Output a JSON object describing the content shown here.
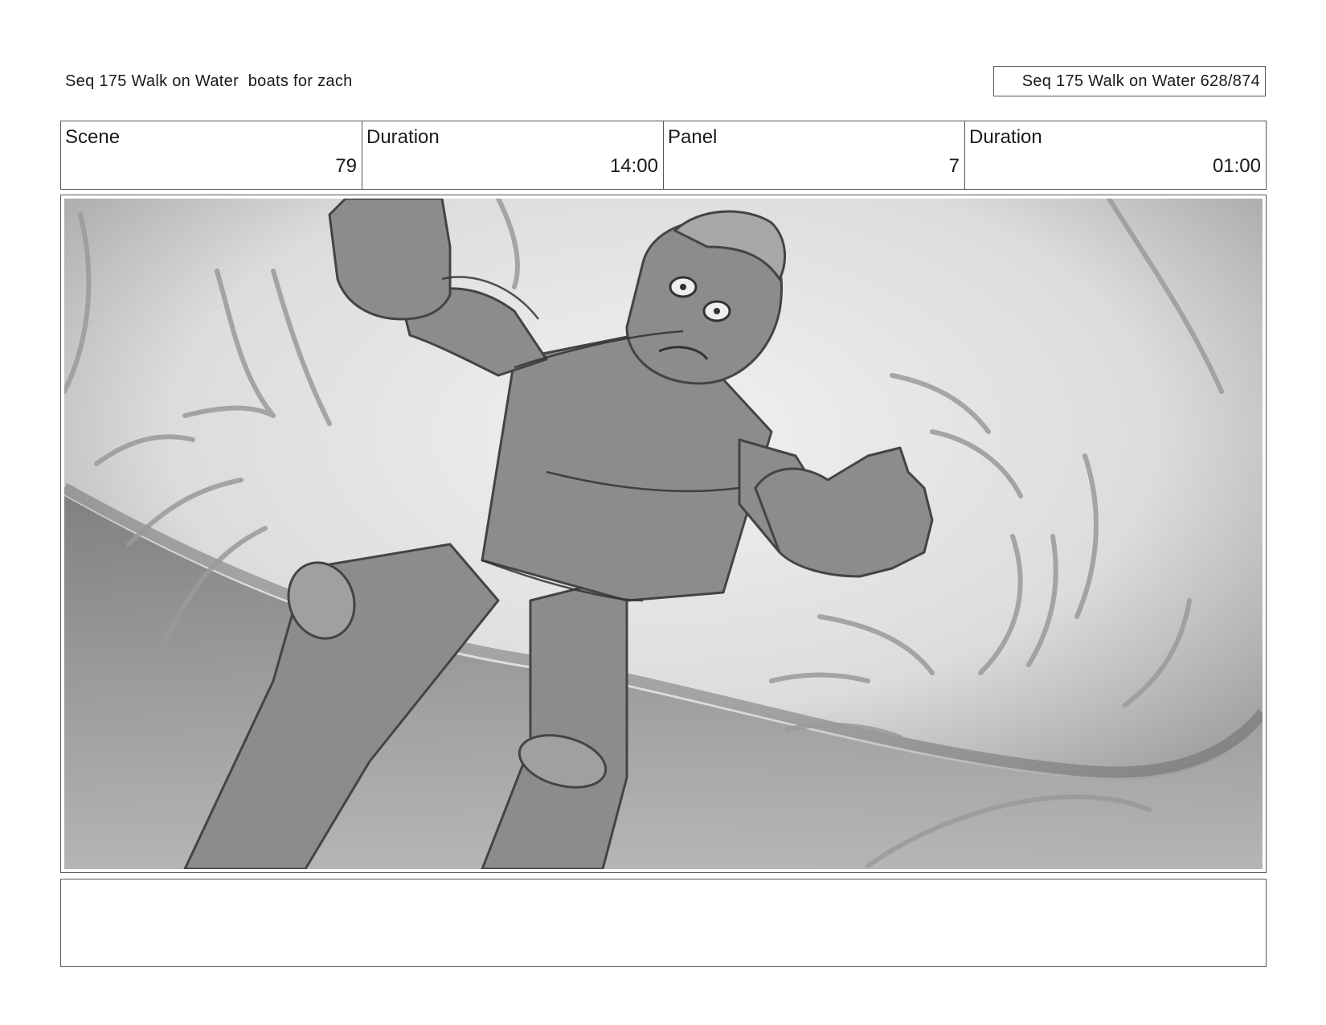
{
  "header": {
    "title": "Seq 175 Walk on Water  boats for zach",
    "page_counter": "Seq 175 Walk on Water 628/874"
  },
  "meta": {
    "scene_label": "Scene",
    "scene_value": "79",
    "scene_duration_label": "Duration",
    "scene_duration_value": "14:00",
    "panel_label": "Panel",
    "panel_value": "7",
    "panel_duration_label": "Duration",
    "panel_duration_value": "01:00"
  },
  "notes": {
    "text": ""
  }
}
